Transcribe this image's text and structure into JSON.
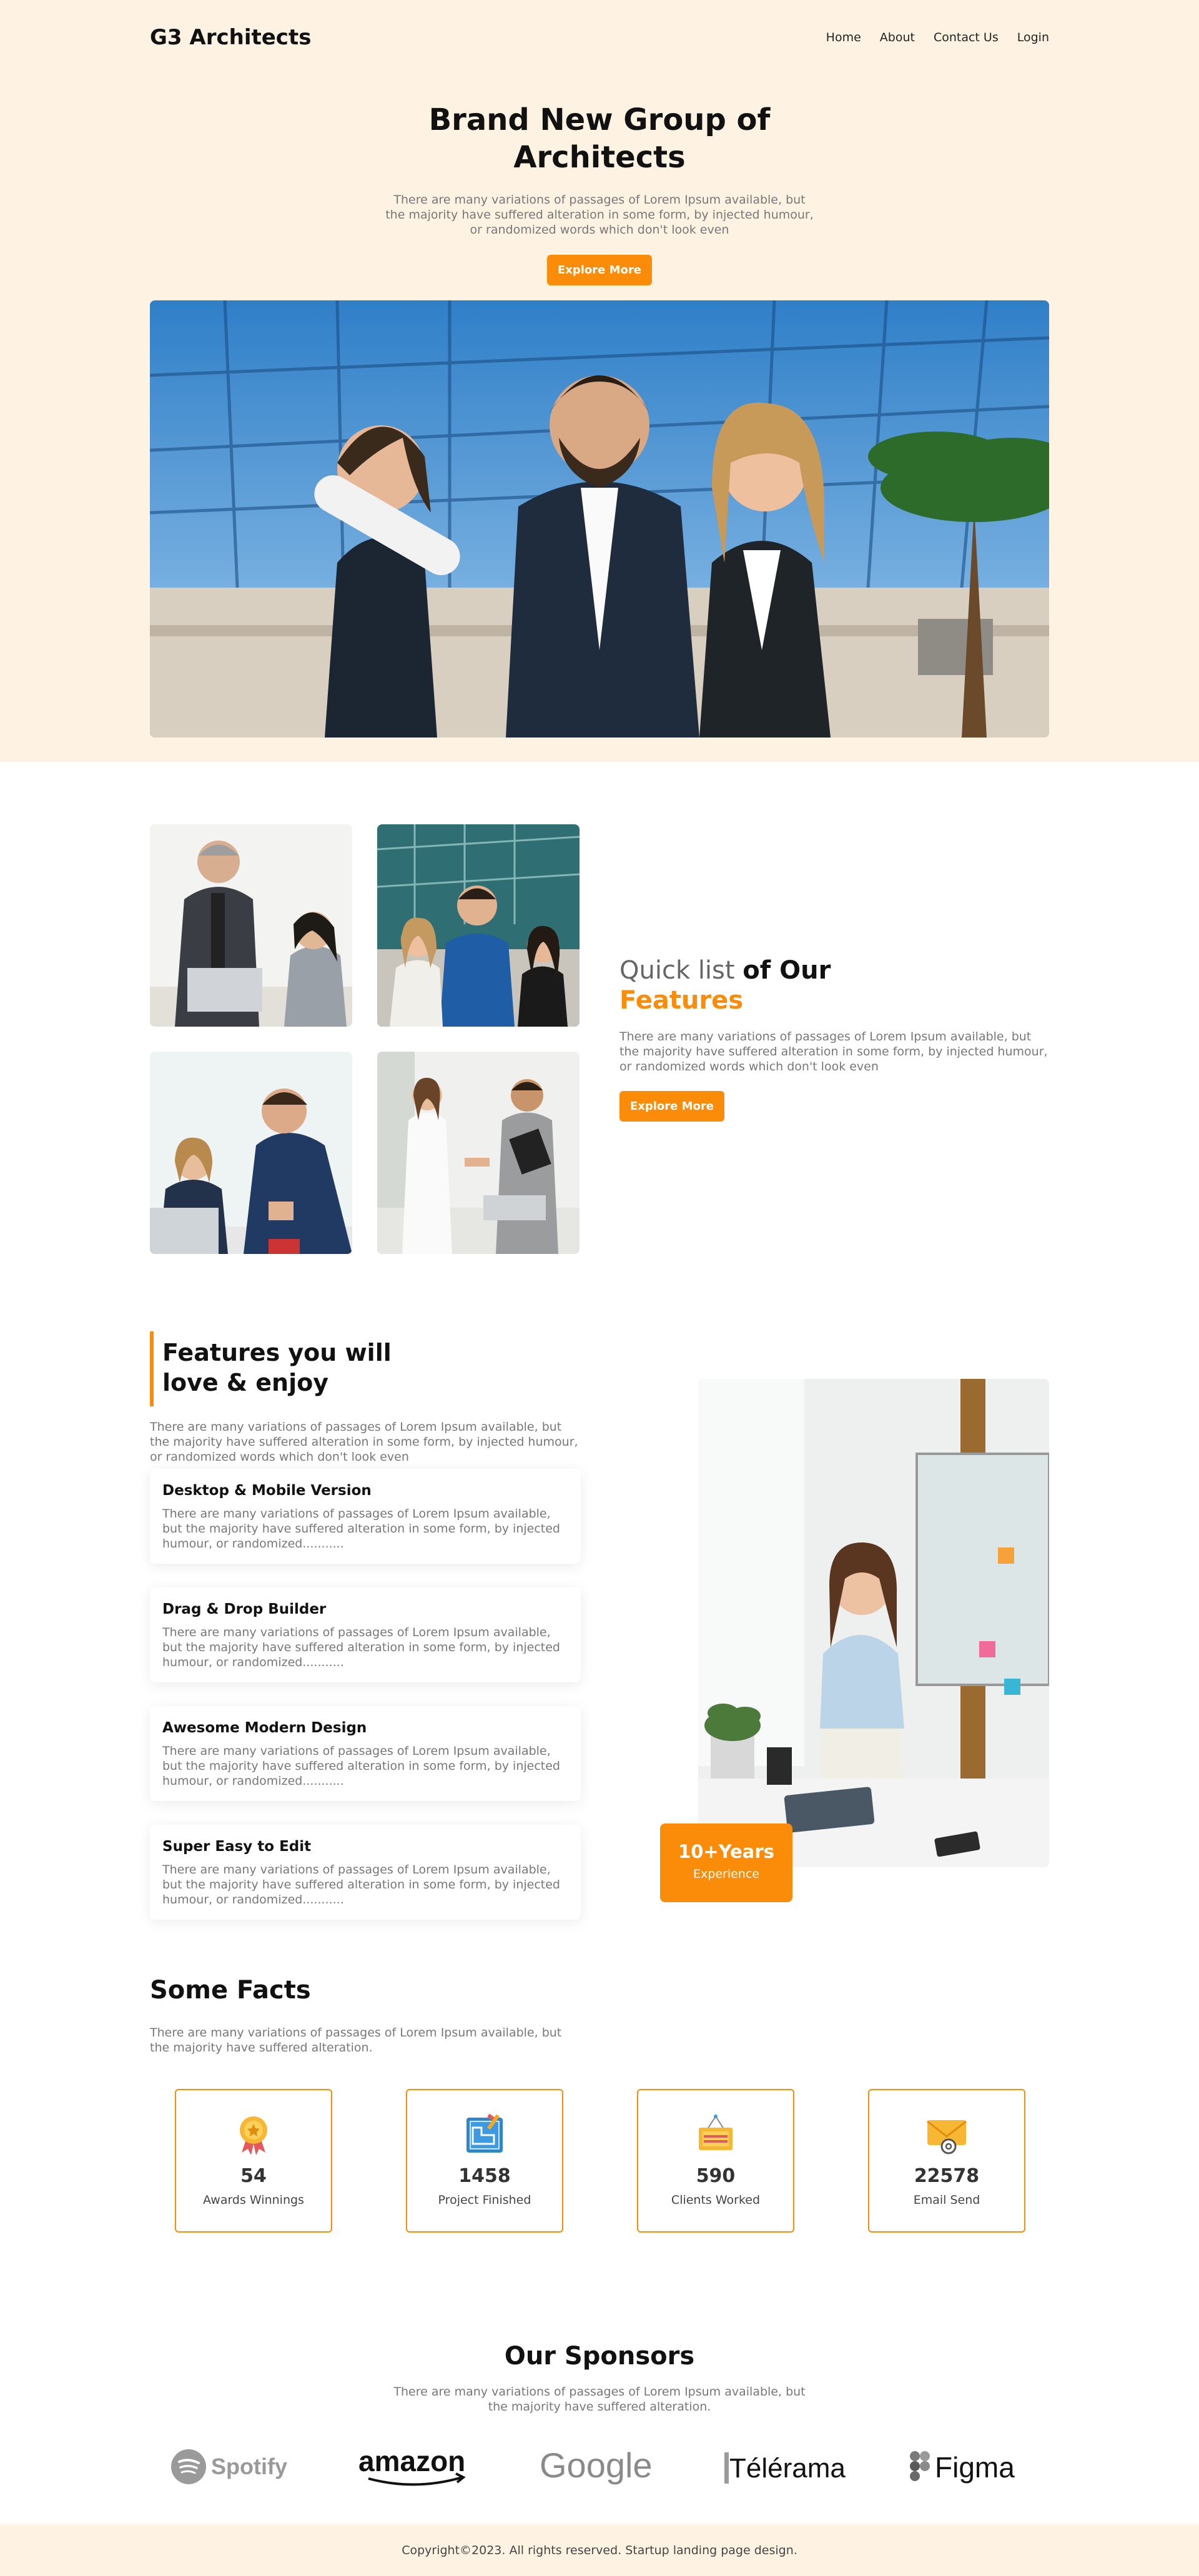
{
  "brand": "G3 Architects",
  "nav": {
    "home": "Home",
    "about": "About",
    "contact": "Contact Us",
    "login": "Login"
  },
  "hero": {
    "title": "Brand New Group of Architects",
    "text": "There are many variations of passages of Lorem Ipsum available, but the majority have suffered alteration in some form, by injected humour, or randomized words which don't look even",
    "button": "Explore More"
  },
  "quick": {
    "title_light": "Quick list ",
    "title_dark": "of Our",
    "title_orange": "Features",
    "text": "There are many variations of passages of Lorem Ipsum available, but the majority have suffered alteration in some form, by injected humour, or randomized words which don't look even",
    "button": "Explore More"
  },
  "features": {
    "title": "Features you will love & enjoy",
    "text": "There are many variations of passages of Lorem Ipsum available, but the majority have suffered alteration in some form, by injected humour, or randomized words which don't look even",
    "cards": [
      {
        "title": "Desktop & Mobile Version",
        "text": "There are many variations of passages of Lorem Ipsum available, but the majority have suffered alteration in some form, by injected humour, or randomized..........."
      },
      {
        "title": "Drag & Drop Builder",
        "text": "There are many variations of passages of Lorem Ipsum available, but the majority have suffered alteration in some form, by injected humour, or randomized..........."
      },
      {
        "title": "Awesome Modern Design",
        "text": "There are many variations of passages of Lorem Ipsum available, but the majority have suffered alteration in some form, by injected humour, or randomized..........."
      },
      {
        "title": "Super Easy to Edit",
        "text": "There are many variations of passages of Lorem Ipsum available, but the majority have suffered alteration in some form, by injected humour, or randomized..........."
      }
    ],
    "badge_big": "10+Years",
    "badge_small": "Experience"
  },
  "facts": {
    "title": "Some Facts",
    "text": "There are many variations of passages of Lorem Ipsum available, but the majority have suffered alteration.",
    "items": [
      {
        "number": "54",
        "label": "Awards Winnings",
        "icon": "award-medal-icon"
      },
      {
        "number": "1458",
        "label": "Project Finished",
        "icon": "blueprint-icon"
      },
      {
        "number": "590",
        "label": "Clients Worked",
        "icon": "work-in-progress-sign-icon"
      },
      {
        "number": "22578",
        "label": "Email Send",
        "icon": "email-envelope-icon"
      }
    ]
  },
  "sponsors": {
    "title": "Our Sponsors",
    "text": "There are many variations of passages of Lorem Ipsum available, but the majority have suffered alteration.",
    "logos": [
      "Spotify",
      "amazon",
      "Google",
      "Télérama",
      "Figma"
    ]
  },
  "footer": "Copyright©2023. All rights reserved. Startup landing page design.",
  "colors": {
    "accent": "#fb8c0a",
    "hero_bg": "#fef3e2"
  }
}
